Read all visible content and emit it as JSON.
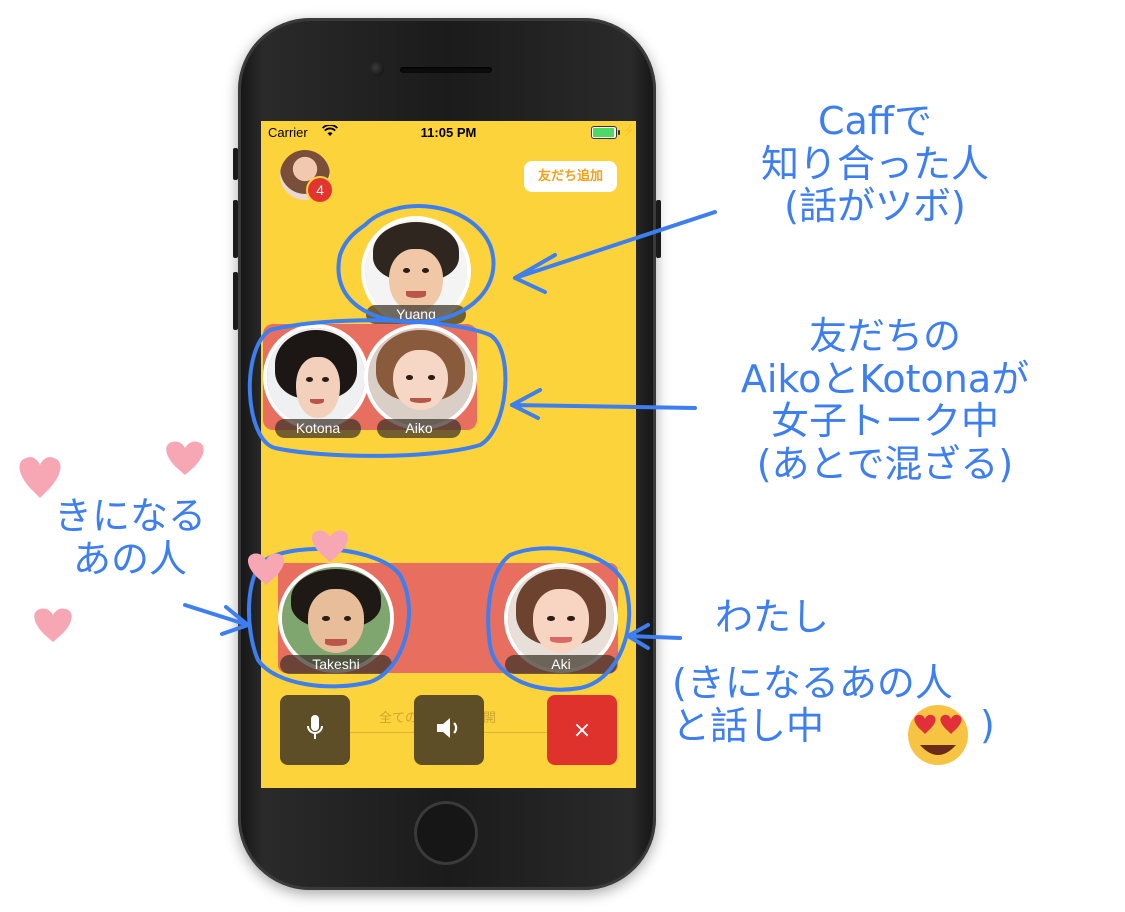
{
  "status_bar": {
    "carrier": "Carrier",
    "time": "11:05 PM"
  },
  "header": {
    "notification_count": "4",
    "add_friend_label": "友だち追加"
  },
  "participants": {
    "yuang": "Yuang",
    "kotona": "Kotona",
    "aiko": "Aiko",
    "takeshi": "Takeshi",
    "aki": "Aki"
  },
  "controls": {
    "public_label": "全ての友だちに公開",
    "close_symbol": "×"
  },
  "annotations": {
    "caff": "Caffで\n知り合った人\n(話がツボ)",
    "friends": "友だちの\nAikoとKotonaが\n女子トーク中\n(あとで混ざる)",
    "crush": "きになる\nあの人",
    "me": "わたし",
    "me_detail": "(きになるあの人\nと話し中",
    "me_close": ")"
  },
  "colors": {
    "screen_bg": "#fdd33c",
    "pill_red": "#e86f5f",
    "annotation_blue": "#3d7ef0",
    "heart_pink": "#f7a7b4"
  },
  "icons": [
    "wifi-icon",
    "battery-icon",
    "globe-icon",
    "mic-icon",
    "speaker-icon",
    "close-icon",
    "heart-icon",
    "heart-eyes-emoji"
  ]
}
